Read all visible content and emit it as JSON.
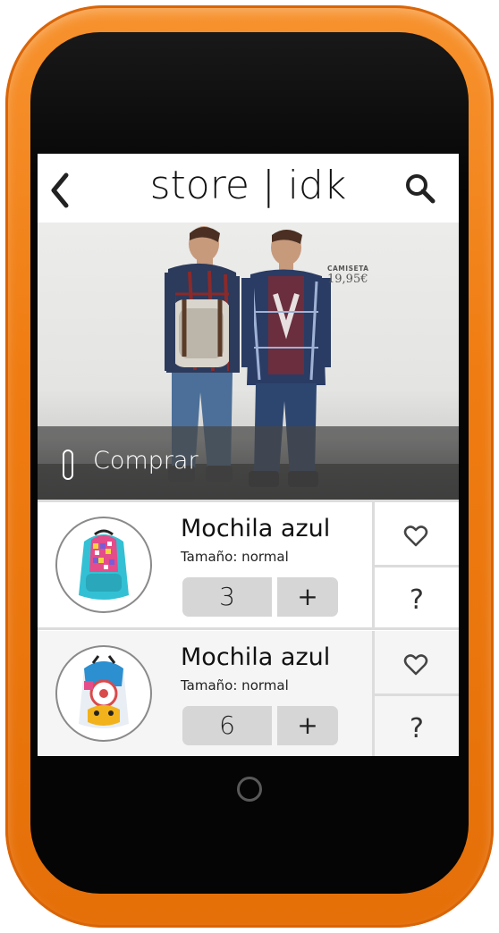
{
  "header": {
    "title": "store | idk"
  },
  "icons": {
    "back": "chevron-left-icon",
    "search": "search-icon",
    "buy": "buy-indicator-icon",
    "favorite": "heart-icon",
    "help": "question-mark-icon",
    "home": "home-button-icon"
  },
  "hero": {
    "tag_label": "CAMISETA",
    "tag_price": "19,95€",
    "buy_label": "Comprar"
  },
  "items": [
    {
      "name": "Mochila azul",
      "size": "Tamaño: normal",
      "quantity": "3",
      "plus_label": "+",
      "help_label": "?"
    },
    {
      "name": "Mochila azul",
      "size": "Tamaño: normal",
      "quantity": "6",
      "plus_label": "+",
      "help_label": "?"
    }
  ],
  "colors": {
    "phone_body": "#ef7c12",
    "bezel": "#050505",
    "divider": "#dcdcdc",
    "button_bg": "#d6d6d6"
  }
}
